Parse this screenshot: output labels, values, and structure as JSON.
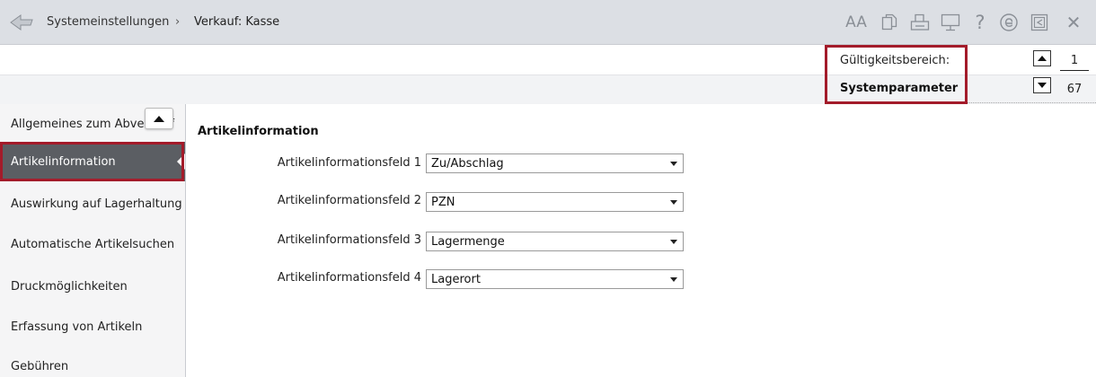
{
  "titlebar": {
    "breadcrumb_parent": "Systemeinstellungen",
    "breadcrumb_separator": "›",
    "breadcrumb_current": "Verkauf: Kasse",
    "font_size_icon_text": "AA",
    "help_icon_text": "?",
    "close_icon_text": "✕",
    "icons": [
      "back-icon",
      "font-size-icon",
      "copy-icon",
      "print-icon",
      "monitor-icon",
      "help-icon",
      "e-icon",
      "minimize-icon",
      "close-icon"
    ]
  },
  "scope": {
    "label": "Gültigkeitsbereich:",
    "value": "Systemparameter",
    "highlight_color": "#a31b2a"
  },
  "pager": {
    "current": "1",
    "total": "67"
  },
  "sidebar": {
    "items": [
      {
        "label": "Allgemeines zum Abverkauf",
        "active": false
      },
      {
        "label": "Artikelinformation",
        "active": true
      },
      {
        "label": "Auswirkung auf Lagerhaltung",
        "active": false
      },
      {
        "label": "Automatische Artikelsuchen",
        "active": false
      },
      {
        "label": "Druckmöglichkeiten",
        "active": false
      },
      {
        "label": "Erfassung von Artikeln",
        "active": false
      },
      {
        "label": "Gebühren",
        "active": false
      }
    ],
    "active_bg": "#5b5e63"
  },
  "main": {
    "section_title": "Artikelinformation",
    "fields": [
      {
        "label": "Artikelinformationsfeld 1",
        "value": "Zu/Abschlag"
      },
      {
        "label": "Artikelinformationsfeld 2",
        "value": "PZN"
      },
      {
        "label": "Artikelinformationsfeld 3",
        "value": "Lagermenge"
      },
      {
        "label": "Artikelinformationsfeld 4",
        "value": "Lagerort"
      }
    ]
  }
}
